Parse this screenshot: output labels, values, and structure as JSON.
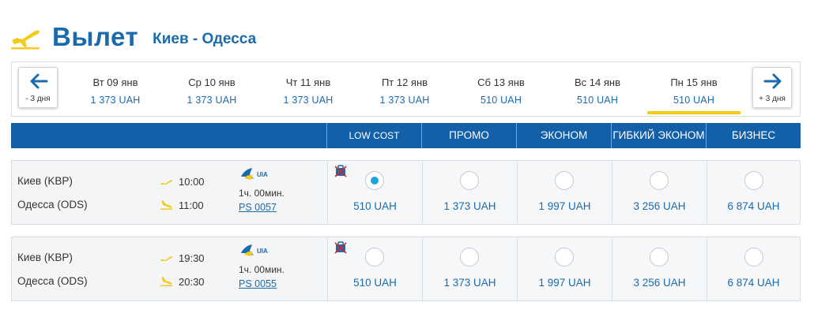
{
  "header": {
    "title": "Вылет",
    "route": "Киев - Одесса"
  },
  "date_bar": {
    "prev_label": "- 3 дня",
    "next_label": "+ 3 дня",
    "dates": [
      {
        "day": "Вт 09 янв",
        "price": "1 373 UAH"
      },
      {
        "day": "Ср 10 янв",
        "price": "1 373 UAH"
      },
      {
        "day": "Чт 11 янв",
        "price": "1 373 UAH"
      },
      {
        "day": "Пт 12 янв",
        "price": "1 373 UAH"
      },
      {
        "day": "Сб 13 янв",
        "price": "510 UAH"
      },
      {
        "day": "Вс 14 янв",
        "price": "510 UAH"
      },
      {
        "day": "Пн 15 янв",
        "price": "510 UAH"
      }
    ],
    "selected_index": 6
  },
  "fare_classes": [
    "LOW COST",
    "ПРОМО",
    "ЭКОНОМ",
    "ГИБКИЙ ЭКОНОМ",
    "БИЗНЕС"
  ],
  "flights": [
    {
      "from_city": "Киев (KBP)",
      "depart_time": "10:00",
      "to_city": "Одесса (ODS)",
      "arrive_time": "11:00",
      "airline_logo": "UIA",
      "duration": "1ч. 00мин.",
      "flight_number": "PS 0057",
      "selected_fare": 0,
      "fares": [
        "510 UAH",
        "1 373 UAH",
        "1 997 UAH",
        "3 256 UAH",
        "6 874 UAH"
      ]
    },
    {
      "from_city": "Киев (KBP)",
      "depart_time": "19:30",
      "to_city": "Одесса (ODS)",
      "arrive_time": "20:30",
      "airline_logo": "UIA",
      "duration": "1ч. 00мин.",
      "flight_number": "PS 0055",
      "selected_fare": -1,
      "fares": [
        "510 UAH",
        "1 373 UAH",
        "1 997 UAH",
        "3 256 UAH",
        "6 874 UAH"
      ]
    }
  ],
  "colors": {
    "brand_blue": "#135fa8",
    "link_blue": "#1a6aac",
    "accent_yellow": "#f2cb1d",
    "radio_checked": "#1aa6e0"
  },
  "icons": [
    "plane-takeoff-icon",
    "arrow-left-icon",
    "arrow-right-icon",
    "plane-landing-icon",
    "no-baggage-icon",
    "uia-logo"
  ]
}
